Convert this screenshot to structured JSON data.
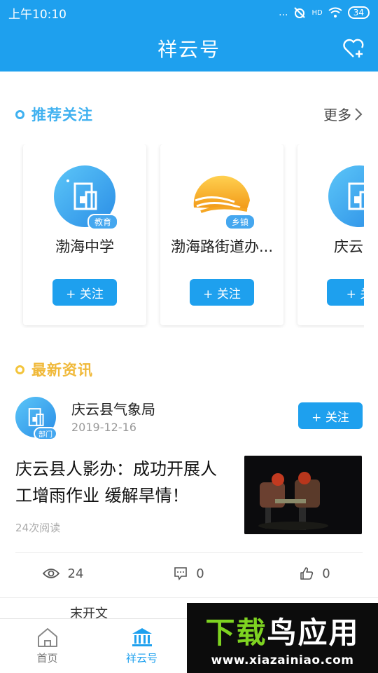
{
  "status_bar": {
    "time": "上午10:10",
    "signal": "...",
    "network": "HD",
    "battery": "34"
  },
  "header": {
    "title": "祥云号"
  },
  "recommend": {
    "title": "推荐关注",
    "more_label": "更多",
    "cards": [
      {
        "name": "渤海中学",
        "badge": "教育",
        "follow_label": "+ 关注"
      },
      {
        "name": "渤海路街道办...",
        "badge": "乡镇",
        "follow_label": "+ 关注"
      },
      {
        "name": "庆云",
        "badge": "",
        "follow_label": "+ 关"
      }
    ]
  },
  "news": {
    "title": "最新资讯",
    "article": {
      "org": "庆云县气象局",
      "badge": "部门",
      "date": "2019-12-16",
      "follow_label": "+ 关注",
      "headline": "庆云县人影办：成功开展人工增雨作业 缓解旱情！",
      "reads": "24次阅读",
      "views": "24",
      "comments": "0",
      "likes": "0"
    },
    "next_peek": "末开文"
  },
  "tabs": [
    {
      "label": "首页",
      "icon": "home-icon"
    },
    {
      "label": "祥云号",
      "icon": "bank-icon",
      "active": true
    }
  ],
  "watermark": {
    "title_green": "下载",
    "title_white": "鸟应用",
    "url": "www.xiazainiao.com"
  },
  "colors": {
    "primary": "#1ea0ee",
    "section_blue": "#3fb1f0",
    "section_yellow": "#f0b93a"
  }
}
